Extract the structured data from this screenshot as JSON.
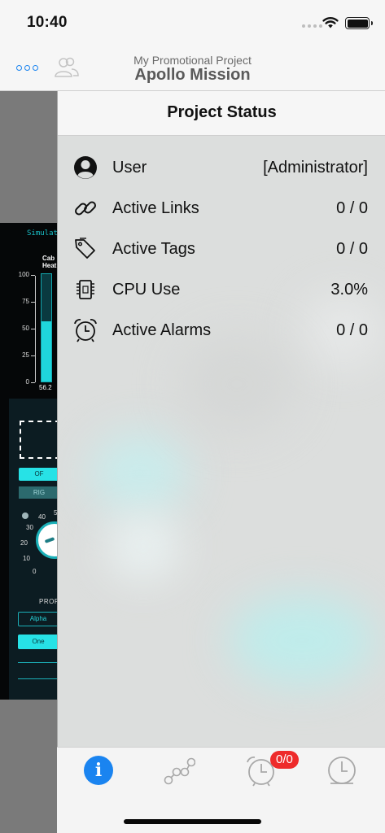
{
  "status_bar": {
    "time": "10:40"
  },
  "nav": {
    "project_subtitle": "My Promotional Project",
    "project_title": "Apollo Mission",
    "more_icon": "ellipsis-circle-icon",
    "users_icon": "users-icon"
  },
  "background_hmi": {
    "sim_label": "Simulat",
    "cabin_label_1": "Cab",
    "cabin_label_2": "Heat",
    "scale_ticks": [
      "100",
      "75",
      "50",
      "25",
      "0"
    ],
    "level_percent": 56.2,
    "level_value": "56.2",
    "on_button": "OF",
    "right_button": "RIG",
    "knob_ticks": [
      "40",
      "30",
      "20",
      "10",
      "0"
    ],
    "knob_tick_5": "5",
    "properties_label": "PROP",
    "alpha_button": "Alpha",
    "one_button": "One"
  },
  "project_status": {
    "title": "Project Status",
    "rows": [
      {
        "label": "User",
        "value": "[Administrator]",
        "icon": "user-icon"
      },
      {
        "label": "Active Links",
        "value": "0 / 0",
        "icon": "link-icon"
      },
      {
        "label": "Active Tags",
        "value": "0 / 0",
        "icon": "tags-icon"
      },
      {
        "label": "CPU Use",
        "value": "3.0%",
        "icon": "cpu-icon"
      },
      {
        "label": "Active Alarms",
        "value": "0 / 0",
        "icon": "alarm-clock-icon"
      }
    ]
  },
  "tab_bar": {
    "tabs": [
      {
        "name": "info",
        "icon": "info-icon",
        "selected": true
      },
      {
        "name": "links",
        "icon": "network-icon",
        "selected": false
      },
      {
        "name": "alarms",
        "icon": "alarm-clock-icon",
        "selected": false
      },
      {
        "name": "history",
        "icon": "clock-icon",
        "selected": false
      }
    ],
    "alarm_badge": "0/0",
    "info_glyph": "i"
  },
  "colors": {
    "accent": "#1a84f0",
    "badge": "#ee2a2a",
    "hmi_cyan": "#27e2e6"
  }
}
